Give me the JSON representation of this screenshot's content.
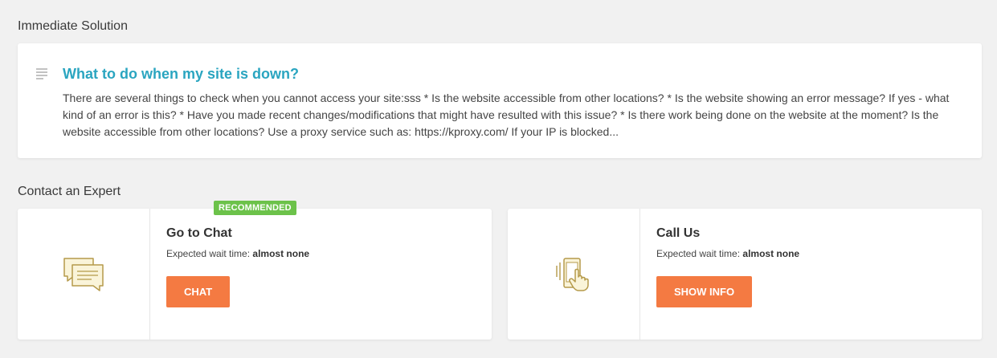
{
  "immediate_solution": {
    "heading": "Immediate Solution",
    "article": {
      "icon": "document-lines-icon",
      "title": "What to do when my site is down?",
      "excerpt": "There are several things to check when you cannot access your site:sss * Is the website accessible from other locations? * Is the website showing an error message? If yes - what kind of an error is this? * Have you made recent changes/modifications that might have resulted with this issue? * Is there work being done on the website at the moment? Is the website accessible from other locations? Use a proxy service such as: https://kproxy.com/ If your IP is blocked..."
    }
  },
  "contact_expert": {
    "heading": "Contact an Expert",
    "options": [
      {
        "icon": "chat-bubbles-icon",
        "badge": "RECOMMENDED",
        "title": "Go to Chat",
        "wait_label": "Expected wait time:",
        "wait_value": "almost none",
        "button_label": "CHAT"
      },
      {
        "icon": "phone-tap-icon",
        "title": "Call Us",
        "wait_label": "Expected wait time:",
        "wait_value": "almost none",
        "button_label": "SHOW INFO"
      }
    ]
  },
  "colors": {
    "accent_title": "#2aa5c0",
    "button": "#f47a42",
    "badge": "#6cc24a",
    "icon_stroke": "#b59a4a",
    "icon_fill": "#faf4d9"
  }
}
